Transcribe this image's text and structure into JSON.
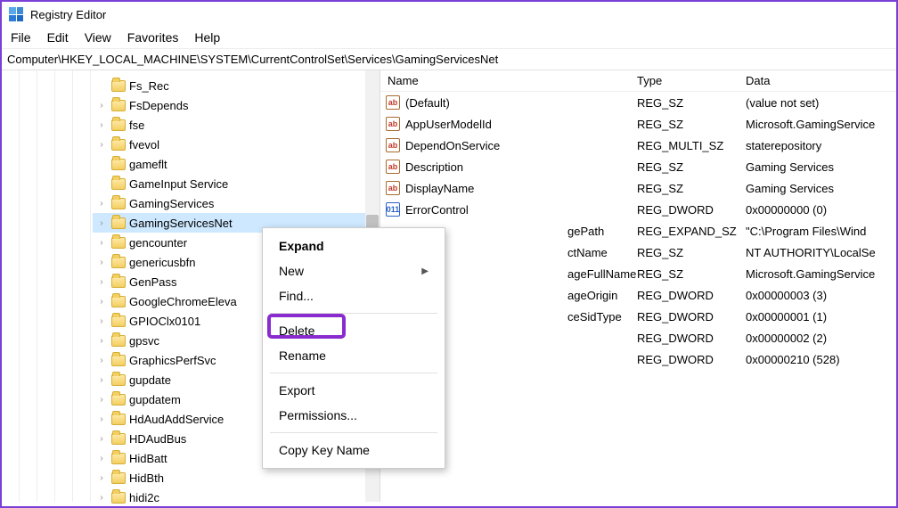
{
  "window": {
    "title": "Registry Editor"
  },
  "menu": {
    "file": "File",
    "edit": "Edit",
    "view": "View",
    "favorites": "Favorites",
    "help": "Help"
  },
  "address": "Computer\\HKEY_LOCAL_MACHINE\\SYSTEM\\CurrentControlSet\\Services\\GamingServicesNet",
  "tree": [
    {
      "label": "Fs_Rec",
      "expander": false
    },
    {
      "label": "FsDepends",
      "expander": true
    },
    {
      "label": "fse",
      "expander": true
    },
    {
      "label": "fvevol",
      "expander": true
    },
    {
      "label": "gameflt",
      "expander": false
    },
    {
      "label": "GameInput Service",
      "expander": false
    },
    {
      "label": "GamingServices",
      "expander": true
    },
    {
      "label": "GamingServicesNet",
      "expander": true,
      "selected": true
    },
    {
      "label": "gencounter",
      "expander": true
    },
    {
      "label": "genericusbfn",
      "expander": true
    },
    {
      "label": "GenPass",
      "expander": true
    },
    {
      "label": "GoogleChromeEleva",
      "expander": true
    },
    {
      "label": "GPIOClx0101",
      "expander": true
    },
    {
      "label": "gpsvc",
      "expander": true
    },
    {
      "label": "GraphicsPerfSvc",
      "expander": true
    },
    {
      "label": "gupdate",
      "expander": true
    },
    {
      "label": "gupdatem",
      "expander": true
    },
    {
      "label": "HdAudAddService",
      "expander": true
    },
    {
      "label": "HDAudBus",
      "expander": true
    },
    {
      "label": "HidBatt",
      "expander": true
    },
    {
      "label": "HidBth",
      "expander": true
    },
    {
      "label": "hidi2c",
      "expander": true
    }
  ],
  "columns": {
    "name": "Name",
    "type": "Type",
    "data": "Data"
  },
  "values": [
    {
      "icon": "str",
      "glyph": "ab",
      "name": "(Default)",
      "type": "REG_SZ",
      "data": "(value not set)"
    },
    {
      "icon": "str",
      "glyph": "ab",
      "name": "AppUserModelId",
      "type": "REG_SZ",
      "data": "Microsoft.GamingService"
    },
    {
      "icon": "str",
      "glyph": "ab",
      "name": "DependOnService",
      "type": "REG_MULTI_SZ",
      "data": "staterepository"
    },
    {
      "icon": "str",
      "glyph": "ab",
      "name": "Description",
      "type": "REG_SZ",
      "data": "Gaming Services"
    },
    {
      "icon": "str",
      "glyph": "ab",
      "name": "DisplayName",
      "type": "REG_SZ",
      "data": "Gaming Services"
    },
    {
      "icon": "dw",
      "glyph": "011",
      "name": "ErrorControl",
      "type": "REG_DWORD",
      "data": "0x00000000 (0)"
    },
    {
      "icon": "str",
      "glyph": "ab",
      "name": "gePath",
      "clip": true,
      "type": "REG_EXPAND_SZ",
      "data": "\"C:\\Program Files\\Wind"
    },
    {
      "icon": "str",
      "glyph": "ab",
      "name": "ctName",
      "clip": true,
      "type": "REG_SZ",
      "data": "NT AUTHORITY\\LocalSe"
    },
    {
      "icon": "str",
      "glyph": "ab",
      "name": "ageFullName",
      "clip": true,
      "type": "REG_SZ",
      "data": "Microsoft.GamingService"
    },
    {
      "icon": "dw",
      "glyph": "011",
      "name": "ageOrigin",
      "clip": true,
      "type": "REG_DWORD",
      "data": "0x00000003 (3)"
    },
    {
      "icon": "dw",
      "glyph": "011",
      "name": "ceSidType",
      "clip": true,
      "type": "REG_DWORD",
      "data": "0x00000001 (1)"
    },
    {
      "icon": "dw",
      "glyph": "011",
      "name": "",
      "clip": true,
      "type": "REG_DWORD",
      "data": "0x00000002 (2)"
    },
    {
      "icon": "dw",
      "glyph": "011",
      "name": "",
      "clip": true,
      "type": "REG_DWORD",
      "data": "0x00000210 (528)"
    }
  ],
  "context_menu": {
    "expand": "Expand",
    "new": "New",
    "find": "Find...",
    "delete": "Delete",
    "rename": "Rename",
    "export": "Export",
    "permissions": "Permissions...",
    "copy_key": "Copy Key Name"
  }
}
